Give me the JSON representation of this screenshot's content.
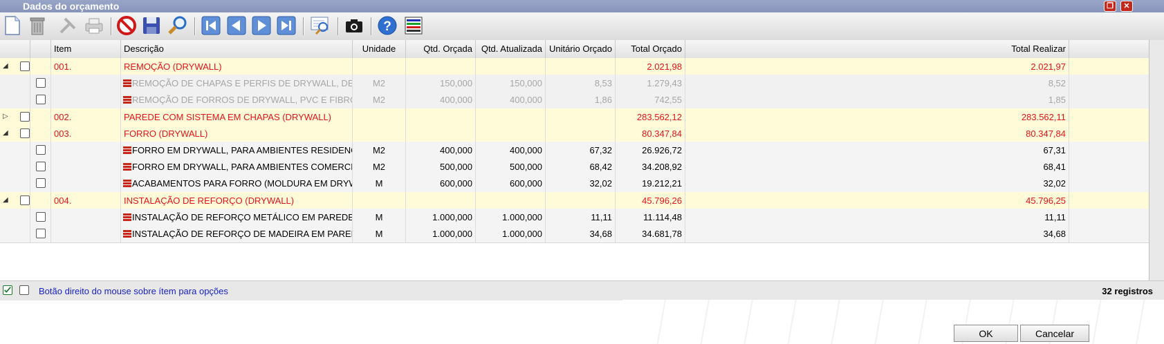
{
  "window": {
    "title": "Dados do orçamento"
  },
  "toolbar": {
    "icons": [
      "new-document",
      "trash",
      "tools",
      "printer",
      "cancel",
      "save",
      "search",
      "first-record",
      "previous-record",
      "next-record",
      "last-record",
      "zoom-view",
      "camera",
      "help",
      "layers"
    ]
  },
  "columns": [
    "Item",
    "Descrição",
    "Unidade",
    "Qtd. Orçada",
    "Qtd. Atualizada",
    "Unitário Orçado",
    "Total Orçado",
    "Total Realizar"
  ],
  "rows": [
    {
      "type": "group",
      "expanded": true,
      "item": "001.",
      "descricao": "REMOÇÃO (DRYWALL)",
      "unidade": "",
      "qtd_orcada": "",
      "qtd_atualizada": "",
      "unitario": "",
      "total_orcado": "2.021,98",
      "total_realizar": "2.021,97"
    },
    {
      "type": "dim",
      "item": "",
      "descricao": "REMOÇÃO DE CHAPAS E PERFIS DE DRYWALL, DE FORMA MANUAL",
      "unidade": "M2",
      "qtd_orcada": "150,000",
      "qtd_atualizada": "150,000",
      "unitario": "8,53",
      "total_orcado": "1.279,43",
      "total_realizar": "8,52"
    },
    {
      "type": "dim",
      "item": "",
      "descricao": "REMOÇÃO DE FORROS DE DRYWALL, PVC E FIBROMINERAL",
      "unidade": "M2",
      "qtd_orcada": "400,000",
      "qtd_atualizada": "400,000",
      "unitario": "1,86",
      "total_orcado": "742,55",
      "total_realizar": "1,85"
    },
    {
      "type": "group",
      "expanded": false,
      "item": "002.",
      "descricao": "PAREDE COM SISTEMA EM CHAPAS (DRYWALL)",
      "unidade": "",
      "qtd_orcada": "",
      "qtd_atualizada": "",
      "unitario": "",
      "total_orcado": "283.562,12",
      "total_realizar": "283.562,11"
    },
    {
      "type": "group",
      "expanded": true,
      "item": "003.",
      "descricao": "FORRO (DRYWALL)",
      "unidade": "",
      "qtd_orcada": "",
      "qtd_atualizada": "",
      "unitario": "",
      "total_orcado": "80.347,84",
      "total_realizar": "80.347,84"
    },
    {
      "type": "item",
      "item": "",
      "descricao": "FORRO EM DRYWALL, PARA AMBIENTES RESIDENCIAIS",
      "unidade": "M2",
      "qtd_orcada": "400,000",
      "qtd_atualizada": "400,000",
      "unitario": "67,32",
      "total_orcado": "26.926,72",
      "total_realizar": "67,31"
    },
    {
      "type": "item",
      "item": "",
      "descricao": "FORRO EM DRYWALL, PARA AMBIENTES COMERCIAIS",
      "unidade": "M2",
      "qtd_orcada": "500,000",
      "qtd_atualizada": "500,000",
      "unitario": "68,42",
      "total_orcado": "34.208,92",
      "total_realizar": "68,41"
    },
    {
      "type": "item",
      "item": "",
      "descricao": "ACABAMENTOS PARA FORRO (MOLDURA EM DRYWALL",
      "unidade": "M",
      "qtd_orcada": "600,000",
      "qtd_atualizada": "600,000",
      "unitario": "32,02",
      "total_orcado": "19.212,21",
      "total_realizar": "32,02"
    },
    {
      "type": "group",
      "expanded": true,
      "item": "004.",
      "descricao": "INSTALAÇÃO DE REFORÇO (DRYWALL)",
      "unidade": "",
      "qtd_orcada": "",
      "qtd_atualizada": "",
      "unitario": "",
      "total_orcado": "45.796,26",
      "total_realizar": "45.796,25"
    },
    {
      "type": "item",
      "item": "",
      "descricao": "INSTALAÇÃO DE REFORÇO METÁLICO EM PAREDE DRYWALL",
      "unidade": "M",
      "qtd_orcada": "1.000,000",
      "qtd_atualizada": "1.000,000",
      "unitario": "11,11",
      "total_orcado": "11.114,48",
      "total_realizar": "11,11"
    },
    {
      "type": "item",
      "item": "",
      "descricao": "INSTALAÇÃO DE REFORÇO DE MADEIRA EM PAREDE DRYWALL",
      "unidade": "M",
      "qtd_orcada": "1.000,000",
      "qtd_atualizada": "1.000,000",
      "unitario": "34,68",
      "total_orcado": "34.681,78",
      "total_realizar": "34,68"
    }
  ],
  "footer": {
    "hint": "Botão direito do mouse sobre ítem para opções",
    "count": "32 registros"
  },
  "buttons": {
    "ok": "OK",
    "cancel": "Cancelar"
  },
  "colors": {
    "group_text": "#e8121a",
    "group_bg": "#fffbd9",
    "hint_text": "#1a22c8"
  }
}
